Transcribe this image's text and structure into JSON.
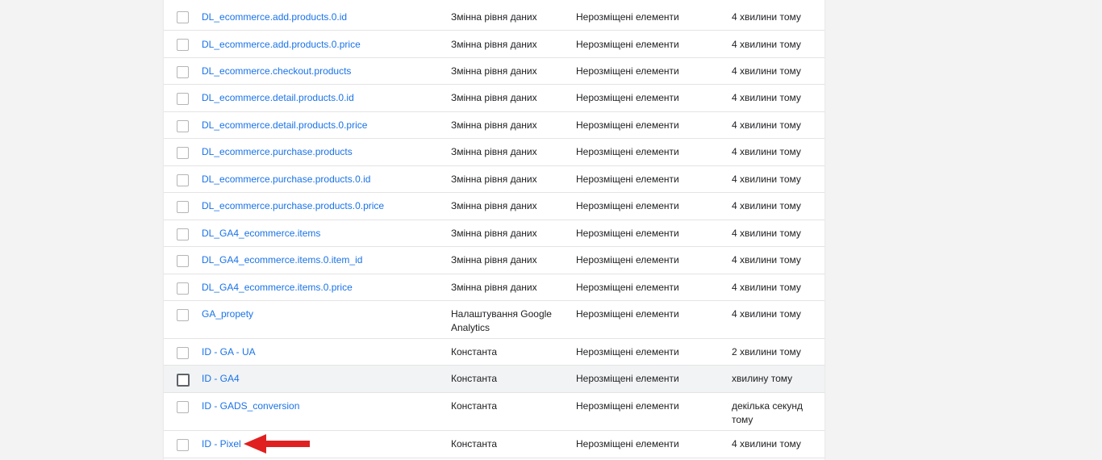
{
  "table": {
    "rows": [
      {
        "name": "DL_ecommerce.add.products.0.id",
        "type": "Змінна рівня даних",
        "folder": "Нерозміщені елементи",
        "edited": "4 хвилини тому"
      },
      {
        "name": "DL_ecommerce.add.products.0.price",
        "type": "Змінна рівня даних",
        "folder": "Нерозміщені елементи",
        "edited": "4 хвилини тому"
      },
      {
        "name": "DL_ecommerce.checkout.products",
        "type": "Змінна рівня даних",
        "folder": "Нерозміщені елементи",
        "edited": "4 хвилини тому"
      },
      {
        "name": "DL_ecommerce.detail.products.0.id",
        "type": "Змінна рівня даних",
        "folder": "Нерозміщені елементи",
        "edited": "4 хвилини тому"
      },
      {
        "name": "DL_ecommerce.detail.products.0.price",
        "type": "Змінна рівня даних",
        "folder": "Нерозміщені елементи",
        "edited": "4 хвилини тому"
      },
      {
        "name": "DL_ecommerce.purchase.products",
        "type": "Змінна рівня даних",
        "folder": "Нерозміщені елементи",
        "edited": "4 хвилини тому"
      },
      {
        "name": "DL_ecommerce.purchase.products.0.id",
        "type": "Змінна рівня даних",
        "folder": "Нерозміщені елементи",
        "edited": "4 хвилини тому"
      },
      {
        "name": "DL_ecommerce.purchase.products.0.price",
        "type": "Змінна рівня даних",
        "folder": "Нерозміщені елементи",
        "edited": "4 хвилини тому"
      },
      {
        "name": "DL_GA4_ecommerce.items",
        "type": "Змінна рівня даних",
        "folder": "Нерозміщені елементи",
        "edited": "4 хвилини тому"
      },
      {
        "name": "DL_GA4_ecommerce.items.0.item_id",
        "type": "Змінна рівня даних",
        "folder": "Нерозміщені елементи",
        "edited": "4 хвилини тому"
      },
      {
        "name": "DL_GA4_ecommerce.items.0.price",
        "type": "Змінна рівня даних",
        "folder": "Нерозміщені елементи",
        "edited": "4 хвилини тому"
      },
      {
        "name": "GA_propety",
        "type": "Налаштування Google Analytics",
        "folder": "Нерозміщені елементи",
        "edited": "4 хвилини тому"
      },
      {
        "name": "ID - GA - UA",
        "type": "Константа",
        "folder": "Нерозміщені елементи",
        "edited": "2 хвилини тому"
      },
      {
        "name": "ID - GA4",
        "type": "Константа",
        "folder": "Нерозміщені елементи",
        "edited": "хвилину тому"
      },
      {
        "name": "ID - GADS_conversion",
        "type": "Константа",
        "folder": "Нерозміщені елементи",
        "edited": "декілька секунд тому"
      },
      {
        "name": "ID - Pixel",
        "type": "Константа",
        "folder": "Нерозміщені елементи",
        "edited": "4 хвилини тому"
      }
    ]
  },
  "colors": {
    "link": "#1a73e8",
    "arrow": "#e02020",
    "hover_row": "#f1f3f4"
  }
}
